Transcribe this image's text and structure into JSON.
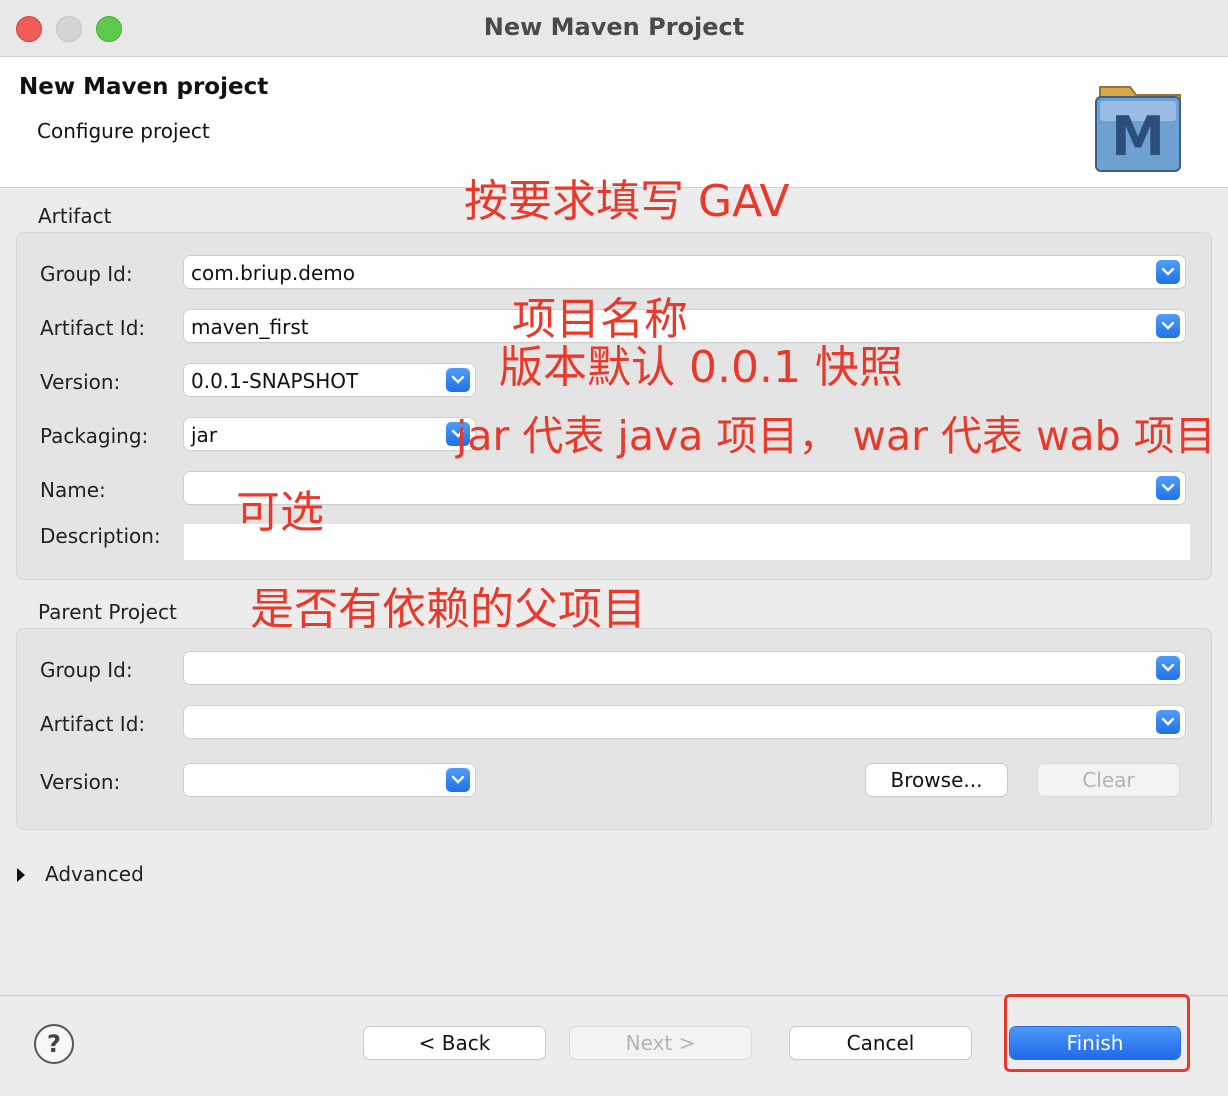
{
  "window": {
    "title": "New Maven Project"
  },
  "header": {
    "title": "New Maven project",
    "subtitle": "Configure project",
    "logo_letter": "M"
  },
  "artifact": {
    "section_label": "Artifact",
    "group_id": {
      "label": "Group Id:",
      "value": "com.briup.demo"
    },
    "artifact_id": {
      "label": "Artifact Id:",
      "value": "maven_first"
    },
    "version": {
      "label": "Version:",
      "value": "0.0.1-SNAPSHOT"
    },
    "packaging": {
      "label": "Packaging:",
      "value": "jar"
    },
    "name": {
      "label": "Name:",
      "value": ""
    },
    "description": {
      "label": "Description:",
      "value": ""
    }
  },
  "parent": {
    "section_label": "Parent Project",
    "group_id": {
      "label": "Group Id:",
      "value": ""
    },
    "artifact_id": {
      "label": "Artifact Id:",
      "value": ""
    },
    "version": {
      "label": "Version:",
      "value": ""
    },
    "browse_label": "Browse...",
    "clear_label": "Clear"
  },
  "advanced": {
    "label": "Advanced"
  },
  "footer": {
    "help_label": "?",
    "back_label": "< Back",
    "next_label": "Next >",
    "cancel_label": "Cancel",
    "finish_label": "Finish"
  },
  "annotations": {
    "gav": "按要求填写 GAV",
    "project_name": "项目名称",
    "version_note": "版本默认 0.0.1 快照",
    "packaging_note": "jar 代表 java 项目， war 代表 wab 项目",
    "optional": "可选",
    "parent_note": "是否有依赖的父项目"
  },
  "colors": {
    "accent": "#2a7cf0",
    "annotation": "#e8392a"
  }
}
